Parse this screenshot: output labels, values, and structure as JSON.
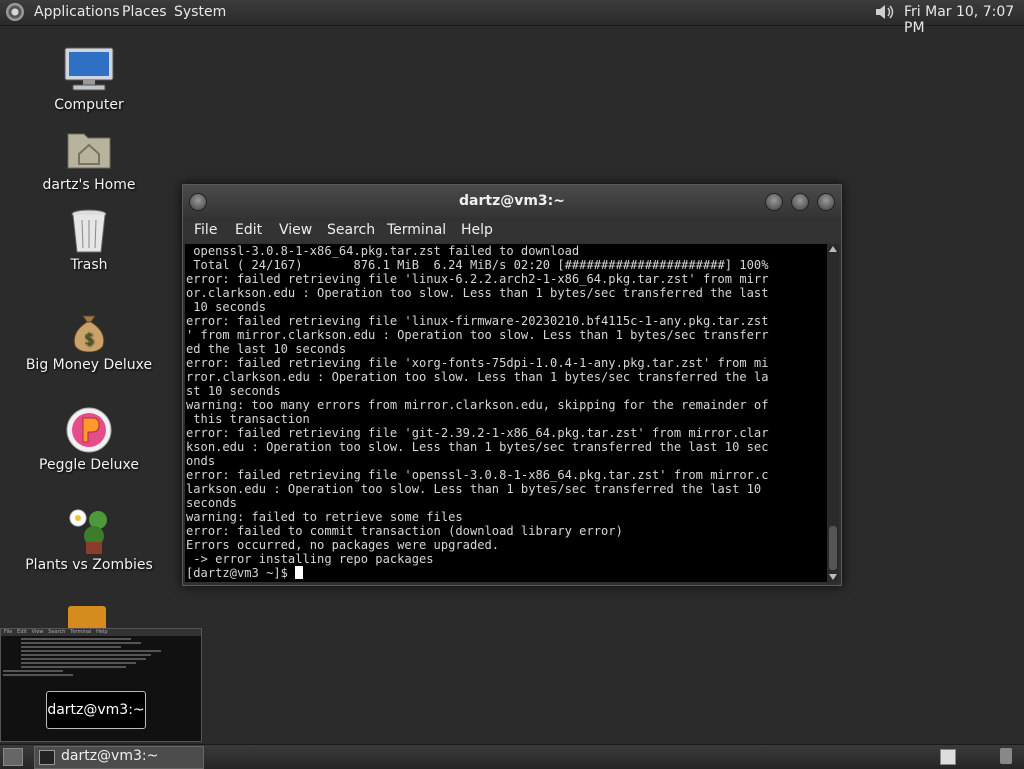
{
  "top_panel": {
    "menus": [
      "Applications",
      "Places",
      "System"
    ],
    "clock": "Fri Mar 10,  7:07 PM"
  },
  "desktop": {
    "icons": [
      {
        "label": "Computer",
        "icon": "computer-icon"
      },
      {
        "label": "dartz's Home",
        "icon": "home-folder-icon"
      },
      {
        "label": "Trash",
        "icon": "trash-icon"
      },
      {
        "label": "Big Money Deluxe",
        "icon": "money-bag-icon"
      },
      {
        "label": "Peggle Deluxe",
        "icon": "peggle-icon"
      },
      {
        "label": "Plants vs Zombies",
        "icon": "plants-icon"
      }
    ]
  },
  "terminal": {
    "title": "dartz@vm3:~",
    "menu": [
      "File",
      "Edit",
      "View",
      "Search",
      "Terminal",
      "Help"
    ],
    "lines": [
      " openssl-3.0.8-1-x86_64.pkg.tar.zst failed to download",
      " Total ( 24/167)       876.1 MiB  6.24 MiB/s 02:20 [######################] 100%",
      "error: failed retrieving file 'linux-6.2.2.arch2-1-x86_64.pkg.tar.zst' from mirr",
      "or.clarkson.edu : Operation too slow. Less than 1 bytes/sec transferred the last",
      " 10 seconds",
      "error: failed retrieving file 'linux-firmware-20230210.bf4115c-1-any.pkg.tar.zst",
      "' from mirror.clarkson.edu : Operation too slow. Less than 1 bytes/sec transferr",
      "ed the last 10 seconds",
      "error: failed retrieving file 'xorg-fonts-75dpi-1.0.4-1-any.pkg.tar.zst' from mi",
      "rror.clarkson.edu : Operation too slow. Less than 1 bytes/sec transferred the la",
      "st 10 seconds",
      "warning: too many errors from mirror.clarkson.edu, skipping for the remainder of",
      " this transaction",
      "error: failed retrieving file 'git-2.39.2-1-x86_64.pkg.tar.zst' from mirror.clar",
      "kson.edu : Operation too slow. Less than 1 bytes/sec transferred the last 10 sec",
      "onds",
      "error: failed retrieving file 'openssl-3.0.8-1-x86_64.pkg.tar.zst' from mirror.c",
      "larkson.edu : Operation too slow. Less than 1 bytes/sec transferred the last 10",
      "seconds",
      "warning: failed to retrieve some files",
      "error: failed to commit transaction (download library error)",
      "Errors occurred, no packages were upgraded.",
      " -> error installing repo packages"
    ],
    "prompt": "[dartz@vm3 ~]$ "
  },
  "thumbnail": {
    "menu": [
      "File",
      "Edit",
      "View",
      "Search",
      "Terminal",
      "Help"
    ],
    "tooltip": "dartz@vm3:~"
  },
  "bottom_panel": {
    "task_label": "dartz@vm3:~"
  }
}
